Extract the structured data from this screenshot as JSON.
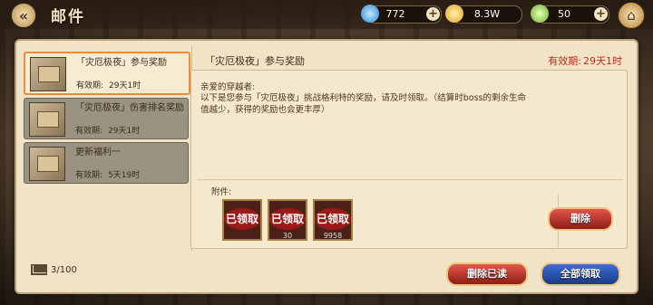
{
  "header": {
    "title": "邮件"
  },
  "resources": [
    {
      "icon": "water-drop-icon",
      "value": "772",
      "color": "#4fb3f0"
    },
    {
      "icon": "gold-coin-icon",
      "value": "8.3W",
      "color": "#f2c440"
    },
    {
      "icon": "green-gem-icon",
      "value": "50",
      "color": "#8bd14e"
    }
  ],
  "mail_list": [
    {
      "name": "「灾厄极夜」参与奖励",
      "exp_label": "有效期:",
      "exp_value": "29天1时",
      "selected": true
    },
    {
      "name": "「灾厄极夜」伤害排名奖励",
      "exp_label": "有效期:",
      "exp_value": "29天1时",
      "selected": false
    },
    {
      "name": "更新福利一",
      "exp_label": "有效期:",
      "exp_value": "5天19时",
      "selected": false
    }
  ],
  "mail_count": "3/100",
  "detail": {
    "title": "「灾厄极夜」参与奖励",
    "exp_label": "有效期:",
    "exp_value": "29天1时",
    "greeting": "亲爱的穿越者:",
    "body": "以下是您参与「灾厄极夜」挑战格利特的奖励，请及时领取。（结算时boss的剩余生命值越少，获得的奖励也会更丰厚）",
    "attachment_label": "附件:",
    "attachments": [
      {
        "stamp": "已领取",
        "count": ""
      },
      {
        "stamp": "已领取",
        "count": "30"
      },
      {
        "stamp": "已领取",
        "count": "9958"
      }
    ],
    "delete_label": "删除"
  },
  "footer": {
    "delete_read_label": "删除已读",
    "claim_all_label": "全部领取"
  }
}
